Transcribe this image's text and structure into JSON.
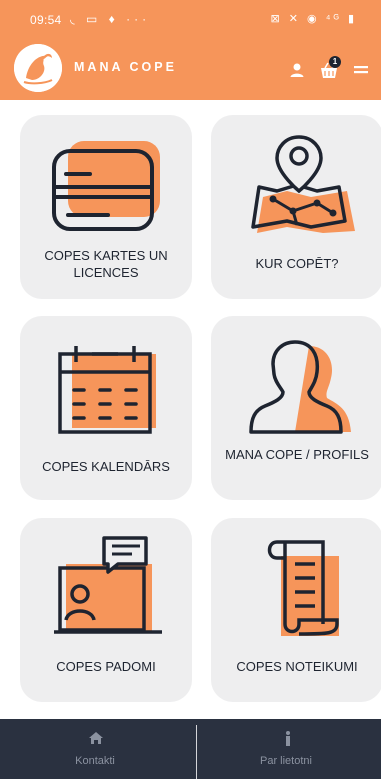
{
  "status_bar": {
    "time": "09:54",
    "left_icons_text": "◟ ▭ ♦ ···",
    "right_icons_text": "⊠ ✕ ◉ ⁴ᴳ ▮"
  },
  "app_bar": {
    "brand": "MANA COPE",
    "cart_count": "1",
    "icons": [
      "user-icon",
      "cart-icon",
      "menu-icon"
    ]
  },
  "tiles": [
    {
      "label": "COPES KARTES UN LICENCES",
      "icon": "license-card-icon"
    },
    {
      "label": "KUR COPĒT?",
      "icon": "map-pin-icon"
    },
    {
      "label": "COPES KALENDĀRS",
      "icon": "calendar-icon"
    },
    {
      "label": "MANA COPE / PROFILS",
      "icon": "profile-icon"
    },
    {
      "label": "COPES PADOMI",
      "icon": "tips-chat-icon"
    },
    {
      "label": "COPES NOTEIKUMI",
      "icon": "rules-scroll-icon"
    }
  ],
  "bottom_nav": {
    "items": [
      {
        "label": "Kontakti",
        "icon": "home-icon"
      },
      {
        "label": "Par lietotni",
        "icon": "info-icon"
      }
    ]
  },
  "colors": {
    "accent": "#f6955a",
    "dark": "#1e2430",
    "tile_bg": "#eeeeef",
    "bottom_bar": "#2a3140"
  }
}
